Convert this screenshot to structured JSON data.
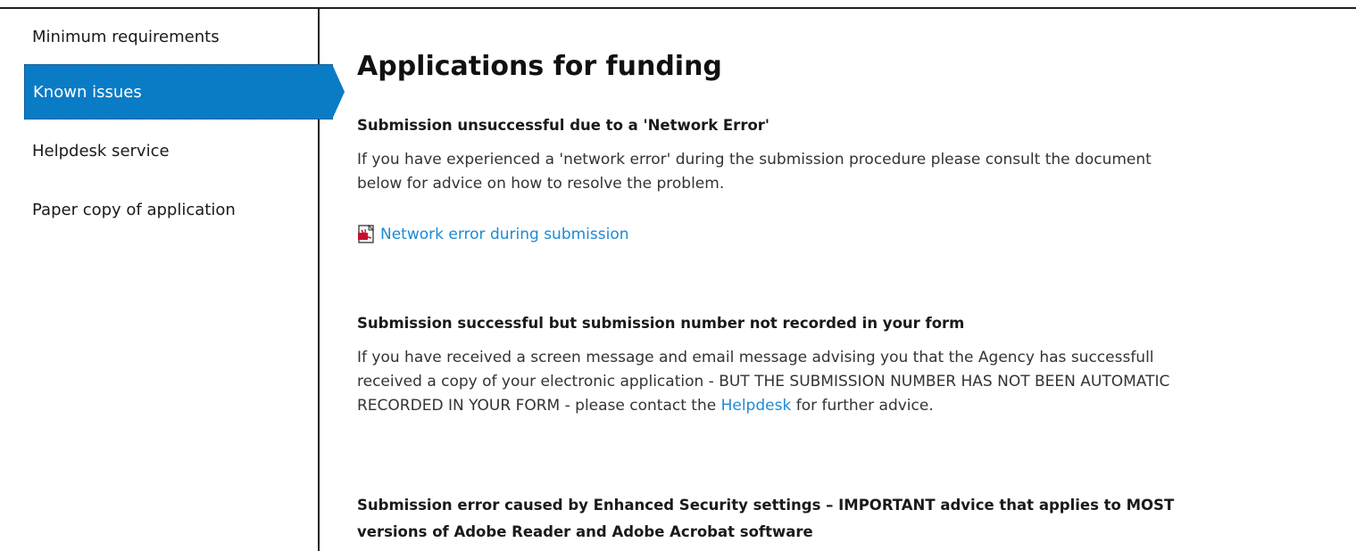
{
  "sidebar": {
    "items": [
      {
        "label": "Minimum requirements",
        "active": false
      },
      {
        "label": "Known issues",
        "active": true
      },
      {
        "label": "Helpdesk service",
        "active": false
      },
      {
        "label": "Paper copy of application",
        "active": false
      }
    ]
  },
  "main": {
    "title": "Applications for funding",
    "sections": [
      {
        "heading": "Submission unsuccessful due to a 'Network Error'",
        "lines": [
          "If you have experienced a 'network error' during the submission procedure please consult the document",
          "below for advice on how to resolve the problem."
        ],
        "link_label": "Network error during submission",
        "link_icon": "pdf-file-icon"
      },
      {
        "heading": "Submission successful but submission number not recorded in your form",
        "lines": [
          "If you have received a screen message and email message advising you that the Agency has successfull",
          "received a copy of your electronic application - BUT THE SUBMISSION NUMBER HAS NOT BEEN AUTOMATIC",
          "RECORDED IN YOUR FORM - please contact the "
        ],
        "inline_link": "Helpdesk",
        "line_end": " for further advice."
      },
      {
        "heading_lines": [
          "Submission error caused by Enhanced Security settings – IMPORTANT advice that applies to MOST",
          "versions of Adobe Reader and Adobe Acrobat software"
        ]
      }
    ]
  },
  "colors": {
    "active_bg": "#0a7cc6",
    "link": "#1c8ad6"
  }
}
